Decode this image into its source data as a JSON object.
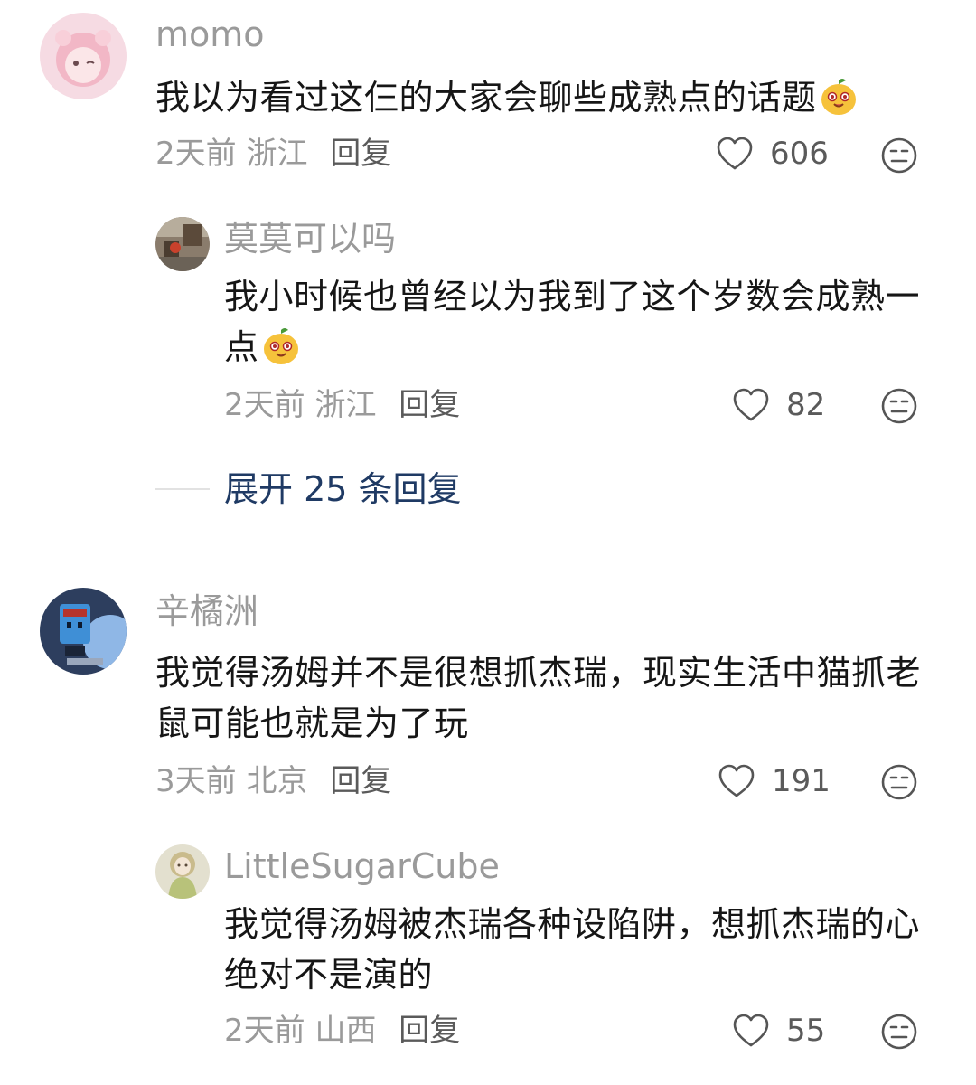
{
  "comments": [
    {
      "username": "momo",
      "text": "我以为看过这仨的大家会聊些成熟点的话题",
      "time": "2天前",
      "location": "浙江",
      "reply_label": "回复",
      "likes": "606",
      "emoji": "mango-face-emoji"
    },
    {
      "username": "莫莫可以吗",
      "text": "我小时候也曾经以为我到了这个岁数会成熟一点",
      "time": "2天前",
      "location": "浙江",
      "reply_label": "回复",
      "likes": "82",
      "emoji": "mango-face-emoji"
    },
    {
      "username": "辛橘洲",
      "text": "我觉得汤姆并不是很想抓杰瑞，现实生活中猫抓老鼠可能也就是为了玩",
      "time": "3天前",
      "location": "北京",
      "reply_label": "回复",
      "likes": "191"
    },
    {
      "username": "LittleSugarCube",
      "text": "我觉得汤姆被杰瑞各种设陷阱，想抓杰瑞的心绝对不是演的",
      "time": "2天前",
      "location": "山西",
      "reply_label": "回复",
      "likes": "55"
    }
  ],
  "expand_replies": {
    "label": "展开 25 条回复"
  },
  "icons": {
    "like": "heart-outline-icon",
    "dislike": "meh-face-icon"
  },
  "colors": {
    "expand_link": "#1f3a64",
    "meta_gray": "#9a9a9a",
    "text": "#161616"
  }
}
